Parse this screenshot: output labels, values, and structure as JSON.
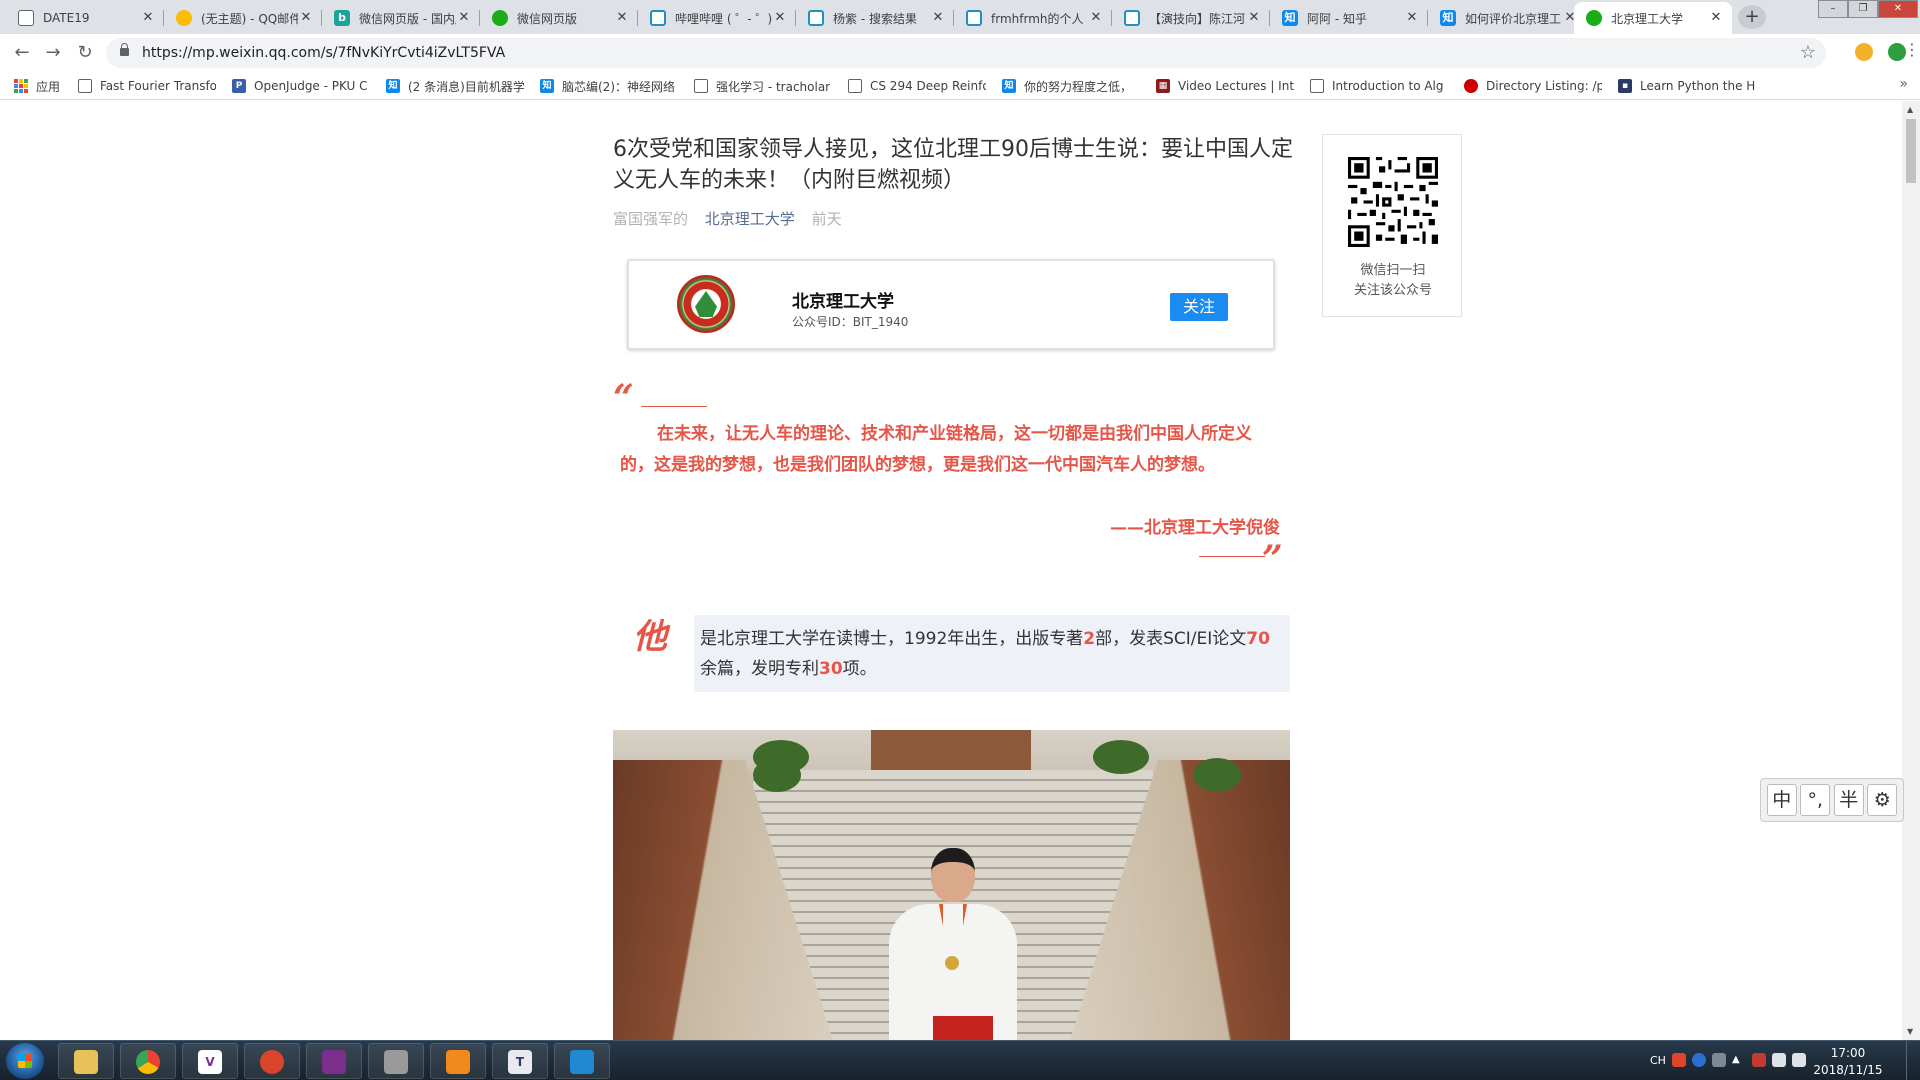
{
  "browser": {
    "tabs": [
      {
        "label": "DATE19",
        "icon": "doc-icon"
      },
      {
        "label": "(无主题) - QQ邮件",
        "icon": "qq-mail-icon"
      },
      {
        "label": "微信网页版 - 国内版",
        "icon": "bing-icon"
      },
      {
        "label": "微信网页版",
        "icon": "wechat-icon"
      },
      {
        "label": "哔哩哔哩 ( ゜- ゜)つ",
        "icon": "bilibili-icon"
      },
      {
        "label": "杨紫 - 搜索结果",
        "icon": "bilibili-icon"
      },
      {
        "label": "frmhfrmh的个人",
        "icon": "bilibili-icon"
      },
      {
        "label": "【演技向】陈江河",
        "icon": "bilibili-icon"
      },
      {
        "label": "阿阿 - 知乎",
        "icon": "zhihu-icon"
      },
      {
        "label": "如何评价北京理工",
        "icon": "zhihu-icon"
      },
      {
        "label": "北京理工大学",
        "icon": "wechat-icon",
        "active": true
      }
    ],
    "close_glyph": "✕",
    "new_tab_glyph": "+",
    "window_controls": {
      "minimize": "–",
      "restore": "❐",
      "close": "✕"
    },
    "url": "https://mp.weixin.qq.com/s/7fNvKiYrCvti4iZvLT5FVA",
    "nav": {
      "back": "←",
      "forward": "→",
      "reload": "↻",
      "star": "☆",
      "menu": "⋮"
    },
    "bookmarks": [
      {
        "label": "应用",
        "icon": "apps-icon"
      },
      {
        "label": "Fast Fourier Transfo",
        "icon": "doc-icon"
      },
      {
        "label": "OpenJudge - PKU C",
        "icon": "openjudge-icon"
      },
      {
        "label": "(2 条消息)目前机器学",
        "icon": "zhihu-icon"
      },
      {
        "label": "脑芯编(2)：神经网络",
        "icon": "zhihu-icon"
      },
      {
        "label": "强化学习 - tracholar",
        "icon": "doc-icon"
      },
      {
        "label": "CS 294 Deep Reinfo",
        "icon": "doc-icon"
      },
      {
        "label": "你的努力程度之低，",
        "icon": "zhihu-icon"
      },
      {
        "label": "Video Lectures | Int",
        "icon": "video-icon"
      },
      {
        "label": "Introduction to Alg",
        "icon": "doc-icon"
      },
      {
        "label": "Directory Listing: /p",
        "icon": "redhat-icon"
      },
      {
        "label": "Learn Python the H",
        "icon": "python-icon"
      }
    ],
    "bookmarks_more": "»"
  },
  "article": {
    "title": "6次受党和国家领导人接见，这位北理工90后博士生说：要让中国人定义无人车的未来！（内附巨燃视频）",
    "meta_source": "富国强军的",
    "meta_account": "北京理工大学",
    "meta_time": "前天",
    "account_card": {
      "name": "北京理工大学",
      "id": "公众号ID：BIT_1940",
      "follow_label": "关注"
    },
    "quote_mark_open": "“",
    "quote_mark_close": "”",
    "quote_text": "在未来，让无人车的理论、技术和产业链格局，这一切都是由我们中国人所定义的，这是我的梦想，也是我们团队的梦想，更是我们这一代中国汽车人的梦想。",
    "quote_author": "——北京理工大学倪俊",
    "bio_char": "他",
    "bio_parts": {
      "p1": "是北京理工大学在读博士，1992年出生，出版专著",
      "n1": "2",
      "p2": "部，发表SCI/EI论文",
      "n2": "70",
      "p3": "余篇，发明专利",
      "n3": "30",
      "p4": "项。"
    }
  },
  "qr_panel": {
    "line1": "微信扫一扫",
    "line2": "关注该公众号"
  },
  "ime_toolbar": {
    "mode": "中",
    "punct": "°,",
    "width": "半",
    "settings": "⚙"
  },
  "taskbar": {
    "apps": [
      "file-explorer-icon",
      "chrome-icon",
      "visual-c-icon",
      "snail-icon",
      "winrar-icon",
      "tool-icon",
      "pdf-icon",
      "typora-icon",
      "vscode-icon"
    ],
    "tray_ime": "CH",
    "time": "17:00",
    "date": "2018/11/15"
  },
  "colors": {
    "accent_red": "#e65547",
    "link_blue": "#576b95",
    "follow_blue": "#1a8cf1",
    "bio_bg": "#eef1f8"
  }
}
